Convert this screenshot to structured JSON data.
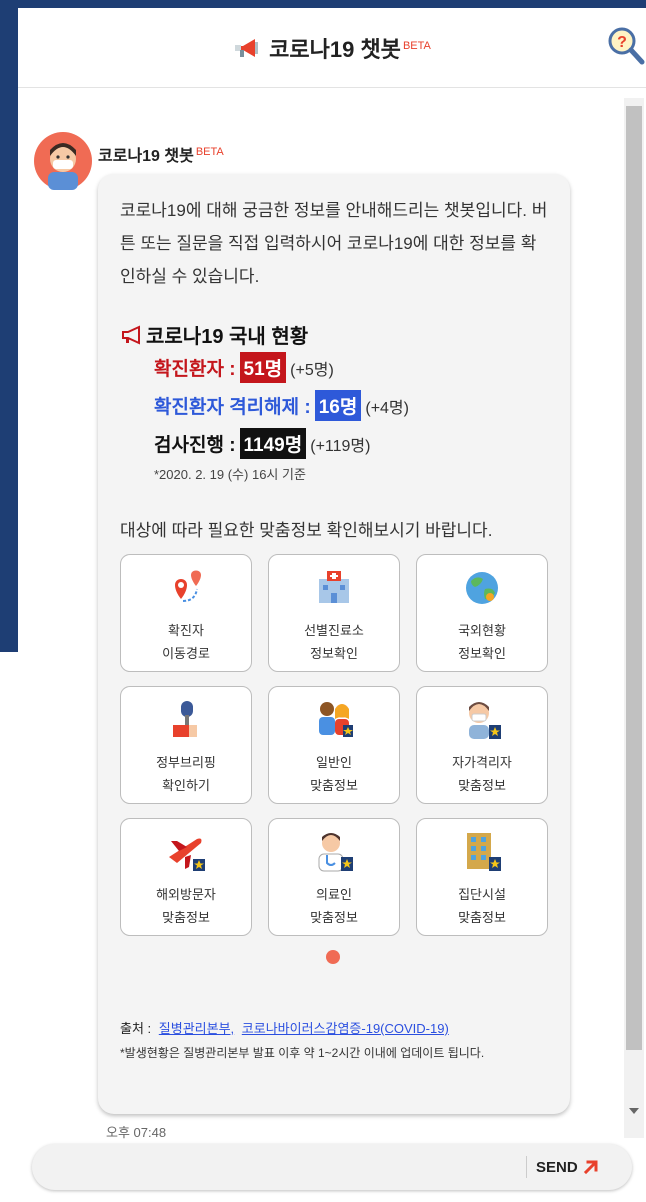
{
  "header": {
    "title": "코로나19 챗봇",
    "beta": "BETA",
    "help_icon": "help-search-icon"
  },
  "bot": {
    "name": "코로나19 챗봇",
    "beta": "BETA"
  },
  "message": {
    "intro": "코로나19에 대해 궁금한 정보를 안내해드리는 챗봇입니다. 버튼 또는 질문을 직접 입력하시어 코로나19에 대한 정보를 확인하실 수 있습니다.",
    "status_title": "코로나19 국내 현황",
    "stats": [
      {
        "label": "확진환자 :",
        "value": "51명",
        "delta": "(+5명)"
      },
      {
        "label": "확진환자 격리해제 :",
        "value": "16명",
        "delta": "(+4명)"
      },
      {
        "label": "검사진행 :",
        "value": "1149명",
        "delta": "(+119명)"
      }
    ],
    "basis": "*2020. 2. 19 (수) 16시 기준",
    "guide": "대상에 따라 필요한 맞춤정보 확인해보시기 바랍니다.",
    "tiles": [
      {
        "line1": "확진자",
        "line2": "이동경로",
        "icon": "location-route-icon"
      },
      {
        "line1": "선별진료소",
        "line2": "정보확인",
        "icon": "clinic-building-icon"
      },
      {
        "line1": "국외현황",
        "line2": "정보확인",
        "icon": "globe-icon"
      },
      {
        "line1": "정부브리핑",
        "line2": "확인하기",
        "icon": "microphone-briefing-icon"
      },
      {
        "line1": "일반인",
        "line2": "맞춤정보",
        "icon": "family-icon"
      },
      {
        "line1": "자가격리자",
        "line2": "맞춤정보",
        "icon": "masked-person-icon"
      },
      {
        "line1": "해외방문자",
        "line2": "맞춤정보",
        "icon": "airplane-icon"
      },
      {
        "line1": "의료인",
        "line2": "맞춤정보",
        "icon": "doctor-icon"
      },
      {
        "line1": "집단시설",
        "line2": "맞춤정보",
        "icon": "facility-building-icon"
      }
    ],
    "source_label": "출처 :",
    "source_links": [
      "질병관리본부,",
      "코로나바이러스감염증-19(COVID-19)"
    ],
    "notice": "*발생현황은 질병관리본부 발표 이후 약 1~2시간 이내에 업데이트 됩니다.",
    "time": "오후 07:48"
  },
  "input": {
    "value": "",
    "placeholder": "",
    "send_label": "SEND"
  },
  "colors": {
    "navy": "#1e3e74",
    "confirmed": "#c4161c",
    "released": "#2e59d9",
    "testing": "#111111",
    "accent": "#f06b54"
  }
}
